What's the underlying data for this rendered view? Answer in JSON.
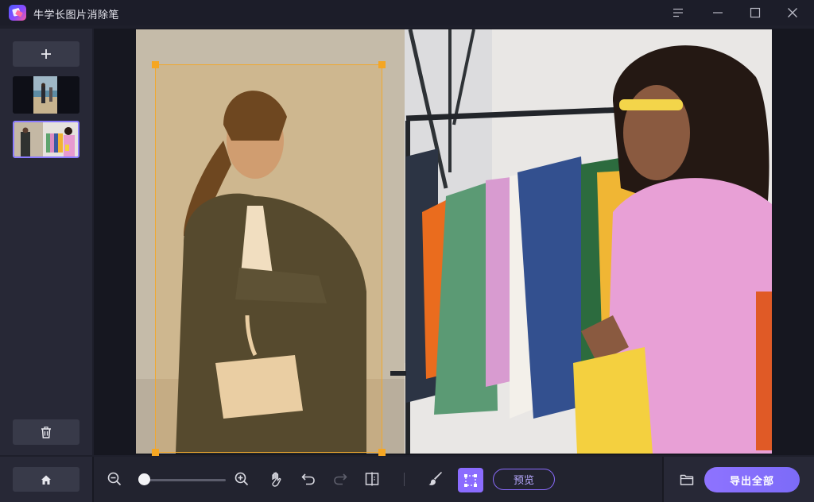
{
  "app": {
    "title": "牛学长图片消除笔",
    "accent_color": "#8b6cff",
    "selection_color": "#f5a623"
  },
  "titlebar": {
    "buttons": [
      "menu-icon",
      "minimize-icon",
      "maximize-icon",
      "close-icon"
    ]
  },
  "sidebar": {
    "add_label": "+",
    "thumbnails": [
      {
        "name": "image-1",
        "selected": false
      },
      {
        "name": "image-2",
        "selected": true
      }
    ],
    "delete_icon": "trash-icon"
  },
  "toolbar": {
    "zoom_level": 0.03,
    "tools": [
      "zoom-out-icon",
      "zoom-in-icon",
      "hand-icon",
      "undo-icon",
      "redo-icon",
      "compare-icon",
      "brush-icon",
      "rect-select-icon"
    ],
    "preview_label": "预览",
    "export_label": "导出全部",
    "home_icon": "home-icon",
    "folder_icon": "folder-icon"
  }
}
